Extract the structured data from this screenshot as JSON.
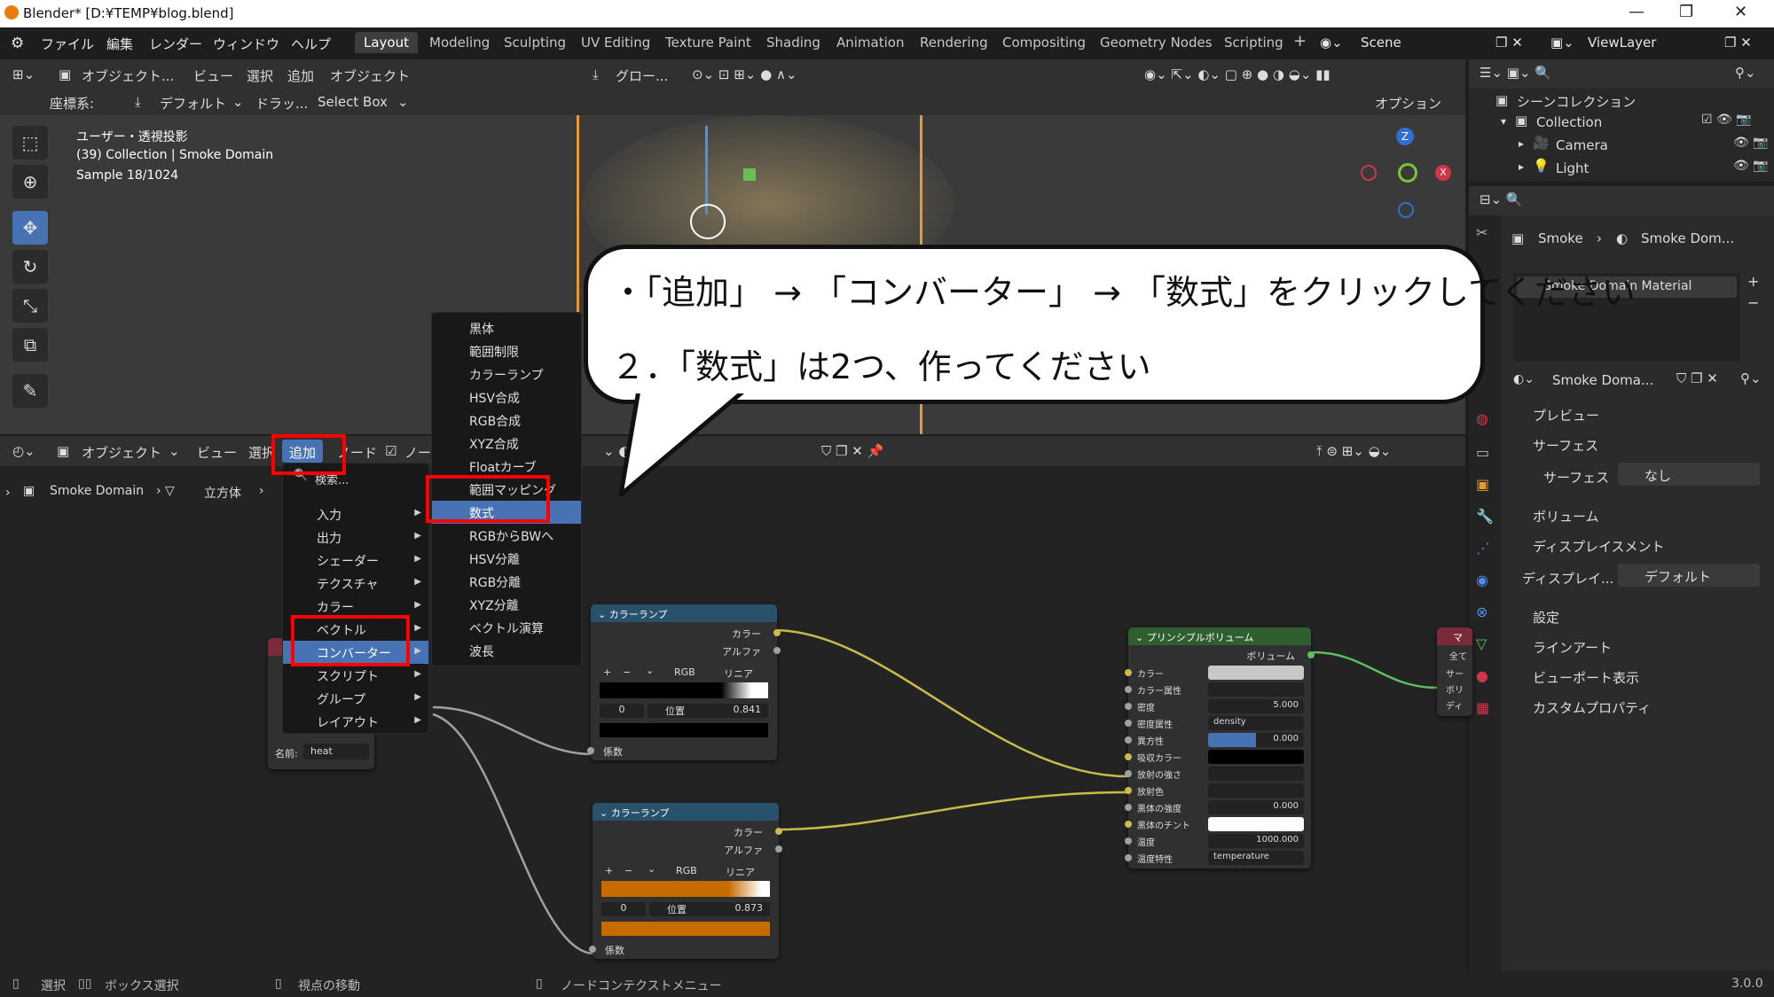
{
  "window": {
    "title": "Blender* [D:¥TEMP¥blog.blend]",
    "minimize": "—",
    "maximize": "❐",
    "close": "✕"
  },
  "menubar": {
    "items": [
      "ファイル",
      "編集",
      "レンダー",
      "ウィンドウ",
      "ヘルプ"
    ],
    "workspaces": [
      "Layout",
      "Modeling",
      "Sculpting",
      "UV Editing",
      "Texture Paint",
      "Shading",
      "Animation",
      "Rendering",
      "Compositing",
      "Geometry Nodes",
      "Scripting"
    ],
    "active_workspace": "Layout",
    "add_tab": "+",
    "scene": "Scene",
    "view_layer": "ViewLayer"
  },
  "viewport_header": {
    "mode": "オブジェクト...",
    "items": [
      "ビュー",
      "選択",
      "追加",
      "オブジェクト"
    ],
    "transform": "グロー...",
    "options": "オプション"
  },
  "tool_settings": {
    "coord_label": "座標系:",
    "coord_value": "デフォルト",
    "drag_label": "ドラッ...",
    "drag_value": "Select Box"
  },
  "viewport_info": {
    "line1": "ユーザー・透視投影",
    "line2": "(39) Collection | Smoke Domain",
    "line3": "Sample 18/1024"
  },
  "gizmo": {
    "z": "Z",
    "x": "X"
  },
  "outliner": {
    "title": "シーンコレクション",
    "items": [
      {
        "label": "Collection"
      },
      {
        "label": "Camera"
      },
      {
        "label": "Light"
      }
    ]
  },
  "properties": {
    "breadcrumb": [
      "Smoke",
      "Smoke Dom..."
    ],
    "material_slot": "Smoke Domain Material",
    "material_name": "Smoke Doma...",
    "panels": [
      "プレビュー",
      "サーフェス",
      "ボリューム",
      "ディスプレイスメント",
      "設定",
      "ラインアート",
      "ビューポート表示",
      "カスタムプロパティ"
    ],
    "surface_label": "サーフェス",
    "surface_value": "なし",
    "displacement_label": "ディスプレイ...",
    "displacement_value": "デフォルト"
  },
  "node_header": {
    "mode": "オブジェクト",
    "items": [
      "ビュー",
      "選択"
    ],
    "add": "追加",
    "node": "ノード",
    "use_nodes": "ノー"
  },
  "node_breadcrumb": {
    "obj": "Smoke Domain",
    "mesh": "立方体"
  },
  "add_menu": {
    "search": "検索...",
    "items": [
      "入力",
      "出力",
      "シェーダー",
      "テクスチャ",
      "カラー",
      "ベクトル",
      "コンバーター",
      "スクリプト",
      "グループ",
      "レイアウト"
    ],
    "highlighted": "コンバーター"
  },
  "converter_menu": {
    "items": [
      "黒体",
      "範囲制限",
      "カラーランプ",
      "HSV合成",
      "RGB合成",
      "XYZ合成",
      "Floatカーブ",
      "範囲マッピング",
      "数式",
      "RGBからBWへ",
      "HSV分離",
      "RGB分離",
      "XYZ分離",
      "ベクトル演算",
      "波長"
    ],
    "highlighted": "数式"
  },
  "attr_node": {
    "name_label": "名前:",
    "name_value": "heat"
  },
  "ramp1": {
    "title": "カラーランプ",
    "out1": "カラー",
    "out2": "アルファ",
    "mode": "RGB",
    "interp": "リニア",
    "index": "0",
    "pos_label": "位置",
    "pos_value": "0.841",
    "in": "係数",
    "plus": "+",
    "minus": "−",
    "chev": "⌄"
  },
  "ramp2": {
    "title": "カラーランプ",
    "out1": "カラー",
    "out2": "アルファ",
    "mode": "RGB",
    "interp": "リニア",
    "index": "0",
    "pos_label": "位置",
    "pos_value": "0.873",
    "in": "係数",
    "plus": "+",
    "minus": "−",
    "chev": "⌄"
  },
  "principled": {
    "title": "プリンシプルボリューム",
    "out": "ボリューム",
    "rows": [
      {
        "label": "カラー",
        "value": ""
      },
      {
        "label": "カラー属性",
        "value": ""
      },
      {
        "label": "密度",
        "value": "5.000"
      },
      {
        "label": "密度属性",
        "value": "density"
      },
      {
        "label": "異方性",
        "value": "0.000"
      },
      {
        "label": "吸収カラー",
        "value": ""
      },
      {
        "label": "放射の強さ",
        "value": ""
      },
      {
        "label": "放射色",
        "value": ""
      },
      {
        "label": "黒体の強度",
        "value": "0.000"
      },
      {
        "label": "黒体のチント",
        "value": ""
      },
      {
        "label": "温度",
        "value": "1000.000"
      },
      {
        "label": "温度特性",
        "value": "temperature"
      }
    ]
  },
  "output_node": {
    "title": "マ",
    "all": "全て",
    "s1": "サー",
    "s2": "ボリ",
    "s3": "ディ"
  },
  "statusbar": {
    "select": "選択",
    "box_select": "ボックス選択",
    "move_view": "視点の移動",
    "context_menu": "ノードコンテクストメニュー",
    "version": "3.0.0"
  },
  "callout": {
    "line1": "・「追加」 → 「コンバーター」 → 「数式」をクリックしてください",
    "line2": "２．「数式」は2つ、作ってください"
  }
}
